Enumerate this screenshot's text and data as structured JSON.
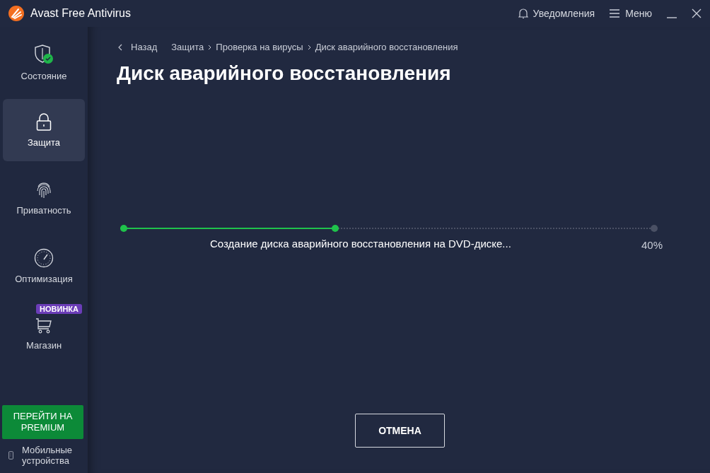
{
  "window": {
    "title": "Avast Free Antivirus",
    "notifications": "Уведомления",
    "menu": "Меню"
  },
  "sidebar": {
    "items": [
      {
        "label": "Состояние",
        "selected": false
      },
      {
        "label": "Защита",
        "selected": true
      },
      {
        "label": "Приватность",
        "selected": false
      },
      {
        "label": "Оптимизация",
        "selected": false
      },
      {
        "label": "Магазин",
        "selected": false,
        "badge": "НОВИНКА"
      }
    ],
    "premium_button": "ПЕРЕЙТИ НА PREMIUM",
    "mobile": "Мобильные устройства"
  },
  "breadcrumb": {
    "back": "Назад",
    "path": [
      "Защита",
      "Проверка на вирусы",
      "Диск аварийного восстановления"
    ]
  },
  "heading": "Диск аварийного восстановления",
  "progress": {
    "level": 0.4,
    "status": "Создание диска аварийного восстановления на DVD-диске...",
    "percent": "40%"
  },
  "cancel_button": "ОТМЕНА"
}
